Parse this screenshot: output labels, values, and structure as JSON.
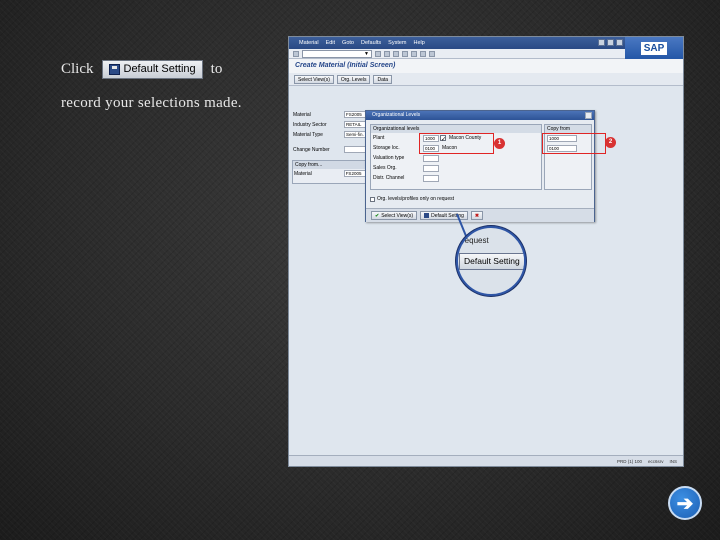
{
  "instruction": {
    "click": "Click",
    "button_label": "Default Setting",
    "to": "to",
    "line2": "record your selections made."
  },
  "sap": {
    "menu": [
      "Material",
      "Edit",
      "Goto",
      "Defaults",
      "System",
      "Help"
    ],
    "logo": "SAP",
    "title": "Create Material (Initial Screen)",
    "app_buttons": [
      "Select View(s)",
      "Org. Levels",
      "Data"
    ],
    "form": [
      {
        "label": "Material",
        "value": "FS2005"
      },
      {
        "label": "Industry Sector",
        "value": "RETAIL"
      },
      {
        "label": "Material Type",
        "value": "Semi-fin."
      }
    ],
    "change_number": "Change Number",
    "copy_from": {
      "header": "Copy from...",
      "label": "Material",
      "value": "FS2005"
    },
    "status": [
      "PRD (1) 100",
      "ecc6srv",
      "INS"
    ]
  },
  "dialog": {
    "title": "Organizational Levels",
    "group_header": "Organizational levels",
    "copy_header": "Copy from",
    "rows": [
      {
        "label": "Plant",
        "value": "1000",
        "checked": true,
        "name": "Macon County"
      },
      {
        "label": "Storage loc.",
        "value": "0100",
        "name": "Macon"
      },
      {
        "label": "Valuation type",
        "value": ""
      },
      {
        "label": "Sales Org.",
        "value": ""
      },
      {
        "label": "Distr. Channel",
        "value": ""
      }
    ],
    "copy_values": [
      "1000",
      "0100"
    ],
    "checkbox": "Org. levels/profiles only on request",
    "buttons": {
      "select": "Select View(s)",
      "default": "Default Setting"
    }
  },
  "callouts": {
    "one": "1",
    "two": "2"
  },
  "magnifier": {
    "text": "request",
    "button": "Default Setting"
  },
  "nav": {
    "next": "➔"
  }
}
